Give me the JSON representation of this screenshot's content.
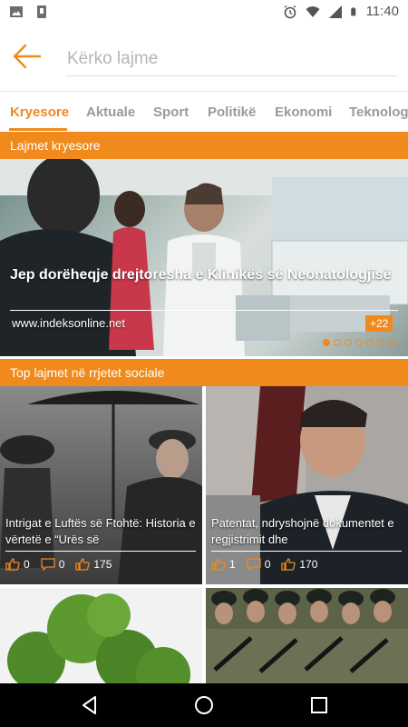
{
  "status_bar": {
    "time": "11:40",
    "left_icons": [
      "image-icon",
      "phone-icon"
    ],
    "right_icons": [
      "alarm-icon",
      "wifi-icon",
      "signal-icon",
      "battery-icon"
    ]
  },
  "search": {
    "placeholder": "Kërko lajme",
    "value": ""
  },
  "tabs": [
    {
      "label": "Kryesore",
      "active": true
    },
    {
      "label": "Aktuale",
      "active": false
    },
    {
      "label": "Sport",
      "active": false
    },
    {
      "label": "Politikë",
      "active": false
    },
    {
      "label": "Ekonomi",
      "active": false
    },
    {
      "label": "Teknologji",
      "active": false
    }
  ],
  "sections": {
    "top_news": "Lajmet kryesore",
    "social_news": "Top lajmet në rrjetet sociale"
  },
  "hero": {
    "title": "Jep dorëheqje drejtoresha e Klinikës së Neonatologjisë",
    "source": "www.indeksonline.net",
    "badge": "+22",
    "slide_count": 7,
    "active_slide": 1
  },
  "cards": [
    {
      "title": "Intrigat e Luftës së Ftohtë: Historia e vërtetë e “Urës së",
      "likes": "0",
      "comments": "0",
      "shares": "175"
    },
    {
      "title": "Patentat, ndryshojnë dokumentet e regjistrimit dhe",
      "likes": "1",
      "comments": "0",
      "shares": "170"
    },
    {
      "title": "",
      "likes": "",
      "comments": "",
      "shares": ""
    },
    {
      "title": "",
      "likes": "",
      "comments": "",
      "shares": ""
    }
  ],
  "colors": {
    "accent": "#f08a1c",
    "tab_inactive": "#9a9a9a",
    "nav_bar": "#000000"
  }
}
